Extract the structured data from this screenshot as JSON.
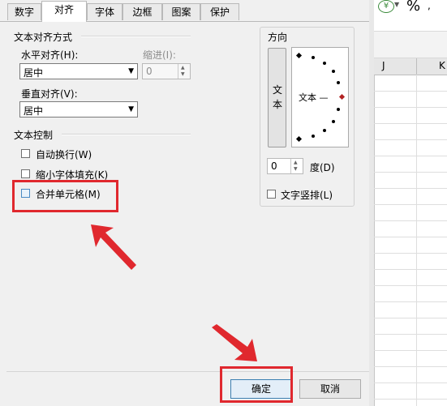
{
  "tabs": [
    {
      "label": "数字"
    },
    {
      "label": "对齐"
    },
    {
      "label": "字体"
    },
    {
      "label": "边框"
    },
    {
      "label": "图案"
    },
    {
      "label": "保护"
    }
  ],
  "text_alignment": {
    "title": "文本对齐方式",
    "horizontal_label": "水平对齐(H):",
    "horizontal_value": "居中",
    "indent_label": "缩进(I):",
    "indent_value": "0",
    "vertical_label": "垂直对齐(V):",
    "vertical_value": "居中"
  },
  "text_control": {
    "title": "文本控制",
    "wrap_text": "自动换行(W)",
    "shrink_to_fit": "缩小字体填充(K)",
    "merge_cells": "合并单元格(M)"
  },
  "orientation": {
    "title": "方向",
    "vertical_text": "文本",
    "horizontal_text": "文本 —",
    "degree_value": "0",
    "degree_label": "度(D)",
    "vertical_stack_label": "文字竖排(L)"
  },
  "buttons": {
    "ok": "确定",
    "cancel": "取消"
  },
  "spreadsheet": {
    "col_j": "J",
    "col_k": "K",
    "percent_icon": "%"
  },
  "colors": {
    "highlight": "#e0282e",
    "dialog_bg": "#f0f0f0"
  }
}
